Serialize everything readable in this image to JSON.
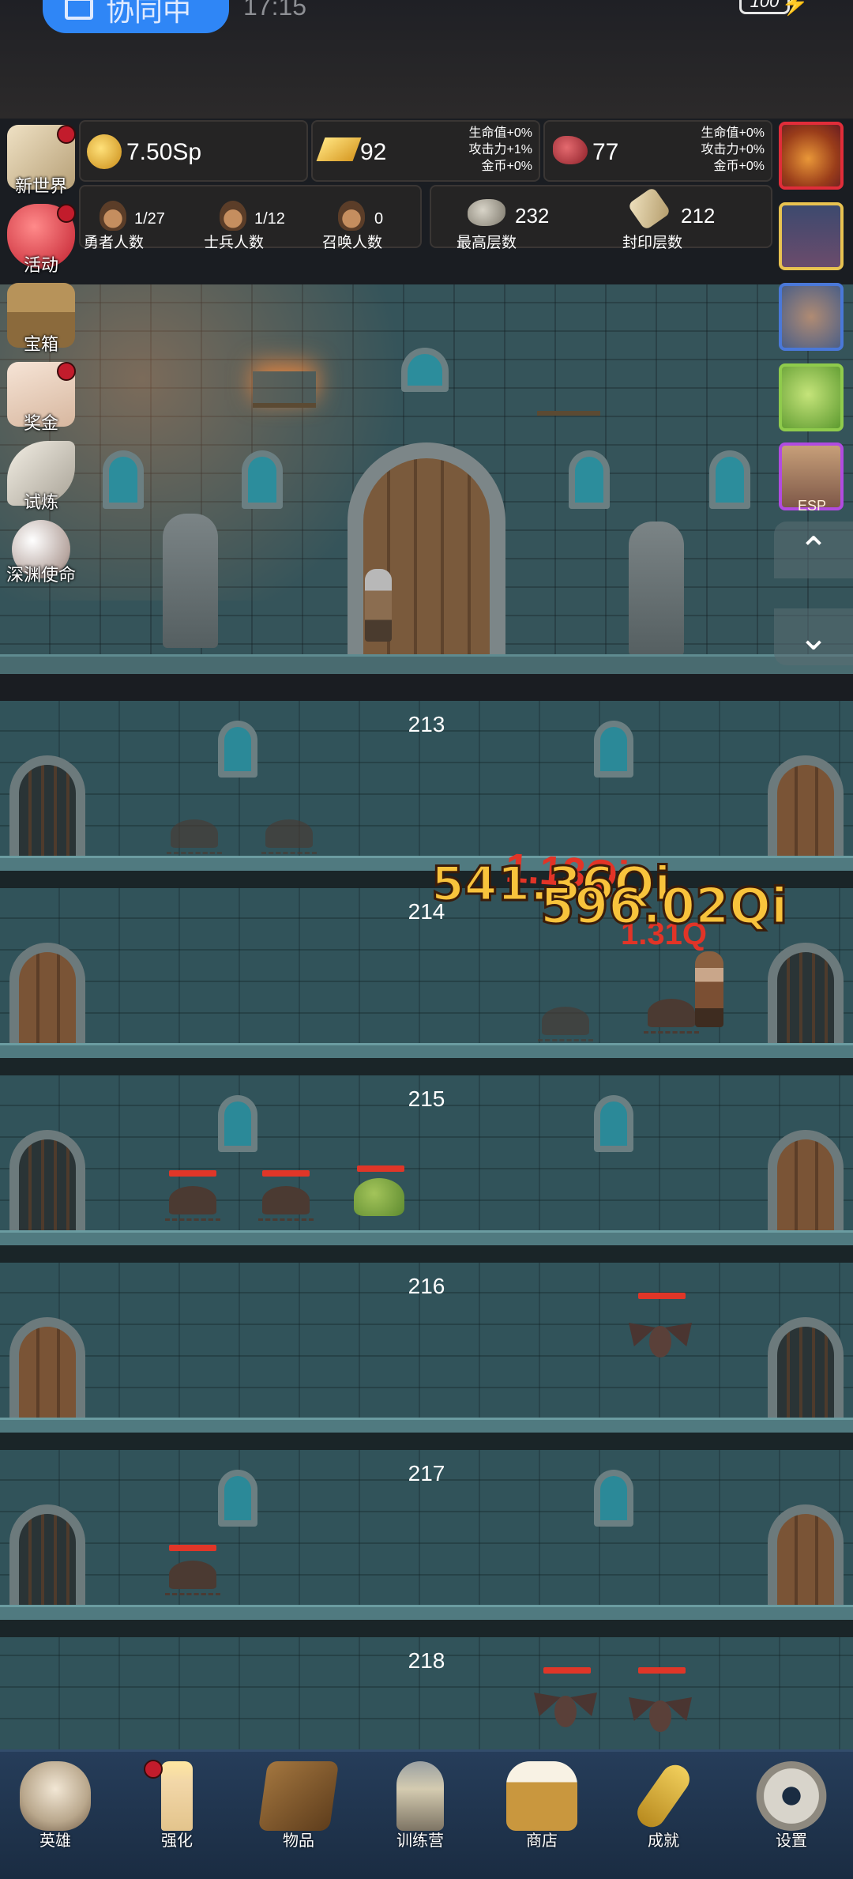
{
  "status_bar": {
    "collab_label": "协同中",
    "time": "17:15",
    "battery": "100"
  },
  "resources": {
    "coins": "7.50Sp",
    "gold_bars": "92",
    "gold_bars_bonus": [
      "生命值+0%",
      "攻击力+1%",
      "金币+0%"
    ],
    "meat": "77",
    "meat_bonus": [
      "生命值+0%",
      "攻击力+0%",
      "金币+0%"
    ]
  },
  "counts": [
    {
      "value": "1/27",
      "label": "勇者人数"
    },
    {
      "value": "1/12",
      "label": "士兵人数"
    },
    {
      "value": "0",
      "label": "召唤人数"
    }
  ],
  "layers": [
    {
      "value": "232",
      "label": "最高层数"
    },
    {
      "value": "212",
      "label": "封印层数"
    }
  ],
  "left_menu": [
    {
      "label": "新世界",
      "badge": true
    },
    {
      "label": "活动",
      "badge": true
    },
    {
      "label": "宝箱",
      "badge": false
    },
    {
      "label": "奖金",
      "badge": true
    },
    {
      "label": "试炼",
      "badge": false
    },
    {
      "label": "深渊使命",
      "badge": false
    }
  ],
  "right_buffs": [
    {
      "icon": "fruit-icon",
      "label": ""
    },
    {
      "icon": "candle-icon",
      "label": ""
    },
    {
      "icon": "backpack-icon",
      "label": ""
    },
    {
      "icon": "slime-icon",
      "label": ""
    },
    {
      "icon": "chest-girl-icon",
      "label": "ESP"
    }
  ],
  "floors": [
    "213",
    "214",
    "215",
    "216",
    "217",
    "218"
  ],
  "damage": {
    "primary": "541.36Qi",
    "secondary": "596.02Qi",
    "background": "1.13Qi",
    "background2": "1.31Q"
  },
  "bottom_nav": [
    {
      "label": "英雄",
      "badge": false
    },
    {
      "label": "强化",
      "badge": true
    },
    {
      "label": "物品",
      "badge": false
    },
    {
      "label": "训练营",
      "badge": false
    },
    {
      "label": "商店",
      "badge": false
    },
    {
      "label": "成就",
      "badge": false
    },
    {
      "label": "设置",
      "badge": false
    }
  ],
  "colors": {
    "accent_blue": "#2f86f6",
    "badge_red": "#c21c2c",
    "damage_gold": "#f8c33c",
    "hp_red": "#e03628"
  }
}
